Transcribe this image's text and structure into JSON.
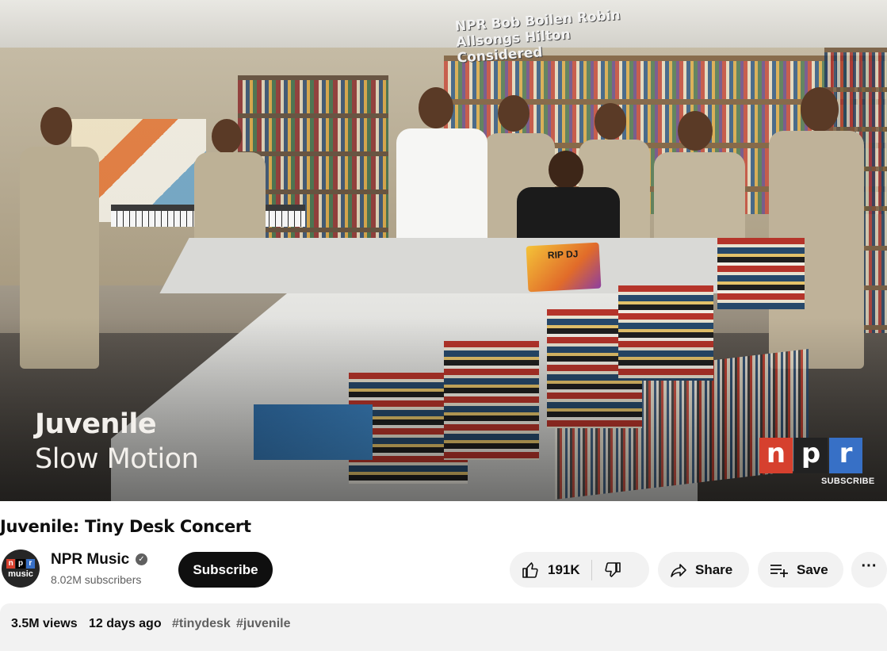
{
  "player": {
    "overlay_artist": "Juvenile",
    "overlay_song": "Slow Motion",
    "set_sign": "NPR Bob Boilen   Robin Allsongs Hilton Considered",
    "desk_sign": "RIP DJ",
    "watermark": {
      "n": "n",
      "p": "p",
      "r": "r",
      "subscribe": "SUBSCRIBE"
    },
    "brand_colors": {
      "red": "#d6402e",
      "black": "#222222",
      "blue": "#3770c6"
    }
  },
  "video": {
    "title": "Juvenile: Tiny Desk Concert"
  },
  "channel": {
    "avatar_npr": {
      "n": "n",
      "p": "p",
      "r": "r"
    },
    "avatar_music": "music",
    "name": "NPR Music",
    "verified_icon": "verified-check-icon",
    "subscribers": "8.02M subscribers",
    "subscribe_label": "Subscribe"
  },
  "actions": {
    "like_count": "191K",
    "like_icon": "thumb-up-icon",
    "dislike_icon": "thumb-down-icon",
    "share_label": "Share",
    "share_icon": "share-arrow-icon",
    "save_label": "Save",
    "save_icon": "playlist-add-icon",
    "more_icon": "more-horizontal-icon",
    "more_glyph": "···"
  },
  "description": {
    "views": "3.5M views",
    "age": "12 days ago",
    "tags": [
      "#tinydesk",
      "#juvenile"
    ]
  }
}
